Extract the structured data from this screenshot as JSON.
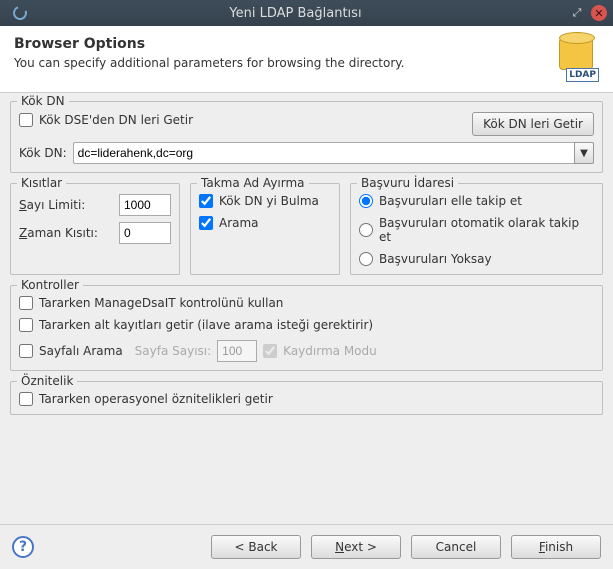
{
  "window": {
    "title": "Yeni LDAP Bağlantısı"
  },
  "header": {
    "title": "Browser Options",
    "subtitle": "You can specify additional parameters for browsing the directory.",
    "icon_label": "LDAP"
  },
  "root_dn": {
    "legend": "Kök DN",
    "fetch_from_dse_label": "Kök DSE'den DN leri Getir",
    "fetch_from_dse_checked": false,
    "fetch_button": "Kök DN leri Getir",
    "root_dn_label": "Kök DN:",
    "root_dn_value": "dc=liderahenk,dc=org"
  },
  "limits": {
    "legend": "Kısıtlar",
    "count_label_pre": "S",
    "count_label_post": "ayı Limiti:",
    "count_value": "1000",
    "time_label_pre": "Z",
    "time_label_post": "aman Kısıtı:",
    "time_value": "0"
  },
  "alias": {
    "legend": "Takma Ad Ayırma",
    "find_label": "Kök DN yi Bulma",
    "find_checked": true,
    "search_label": "Arama",
    "search_checked": true
  },
  "referrals": {
    "legend": "Başvuru İdaresi",
    "manual": "Başvuruları elle takip et",
    "auto": "Başvuruları otomatik olarak takip et",
    "ignore": "Başvuruları Yoksay",
    "selected": "manual"
  },
  "controls": {
    "legend": "Kontroller",
    "managedsait_label": "Tararken ManageDsaIT kontrolünü kullan",
    "managedsait_checked": false,
    "subentries_label": "Tararken alt kayıtları getir (ilave arama isteği gerektirir)",
    "subentries_checked": false,
    "paged_label": "Sayfalı Arama",
    "paged_checked": false,
    "page_count_label": "Sayfa Sayısı:",
    "page_count_value": "100",
    "scroll_mode_label": "Kaydırma Modu",
    "scroll_mode_checked": true
  },
  "attributes": {
    "legend": "Öznitelik",
    "operational_label": "Tararken operasyonel öznitelikleri getir",
    "operational_checked": false
  },
  "footer": {
    "back": "< Back",
    "next_pre": "N",
    "next_post": "ext >",
    "cancel": "Cancel",
    "finish_pre": "F",
    "finish_post": "inish"
  }
}
